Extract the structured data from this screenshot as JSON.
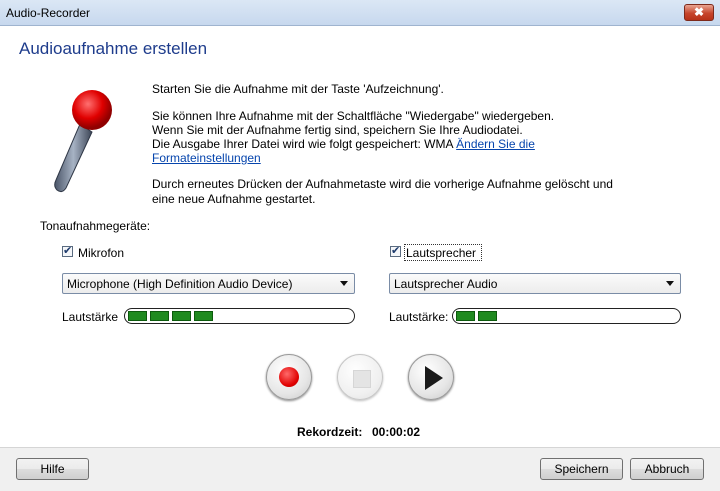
{
  "window": {
    "title": "Audio-Recorder",
    "close_glyph": "✖"
  },
  "heading": "Audioaufnahme erstellen",
  "info": {
    "line1": "Starten Sie die Aufnahme mit der Taste 'Aufzeichnung'.",
    "line2": "Sie können Ihre Aufnahme mit der Schaltfläche \"Wiedergabe\" wiedergeben.",
    "line3": "Wenn Sie mit der Aufnahme fertig sind, speichern Sie Ihre Audiodatei.",
    "line4_prefix": "Die Ausgabe Ihrer Datei wird wie folgt gespeichert: WMA ",
    "link_part1": "Ändern Sie die",
    "link_part2": "Formateinstellungen",
    "line5": "Durch erneutes Drücken der Aufnahmetaste wird die vorherige Aufnahme gelöscht und",
    "line6": "eine neue Aufnahme gestartet."
  },
  "devices": {
    "section_label": "Tonaufnahmegeräte:",
    "mic": {
      "checkbox_label": "Mikrofon",
      "checked": true,
      "selected": "Microphone (High Definition Audio Device)",
      "volume_label": "Lautstärke",
      "level_segments": 4
    },
    "speaker": {
      "checkbox_label": "Lautsprecher",
      "checked": true,
      "selected": "Lautsprecher Audio",
      "volume_label": "Lautstärke:",
      "level_segments": 2
    }
  },
  "record_time": {
    "label": "Rekordzeit:",
    "value": "00:00:02"
  },
  "buttons": {
    "help": "Hilfe",
    "save": "Speichern",
    "cancel": "Abbruch"
  },
  "colors": {
    "heading": "#1e3c8c",
    "link": "#0645ad",
    "level": "#1f8a1f",
    "record": "#e00000"
  }
}
